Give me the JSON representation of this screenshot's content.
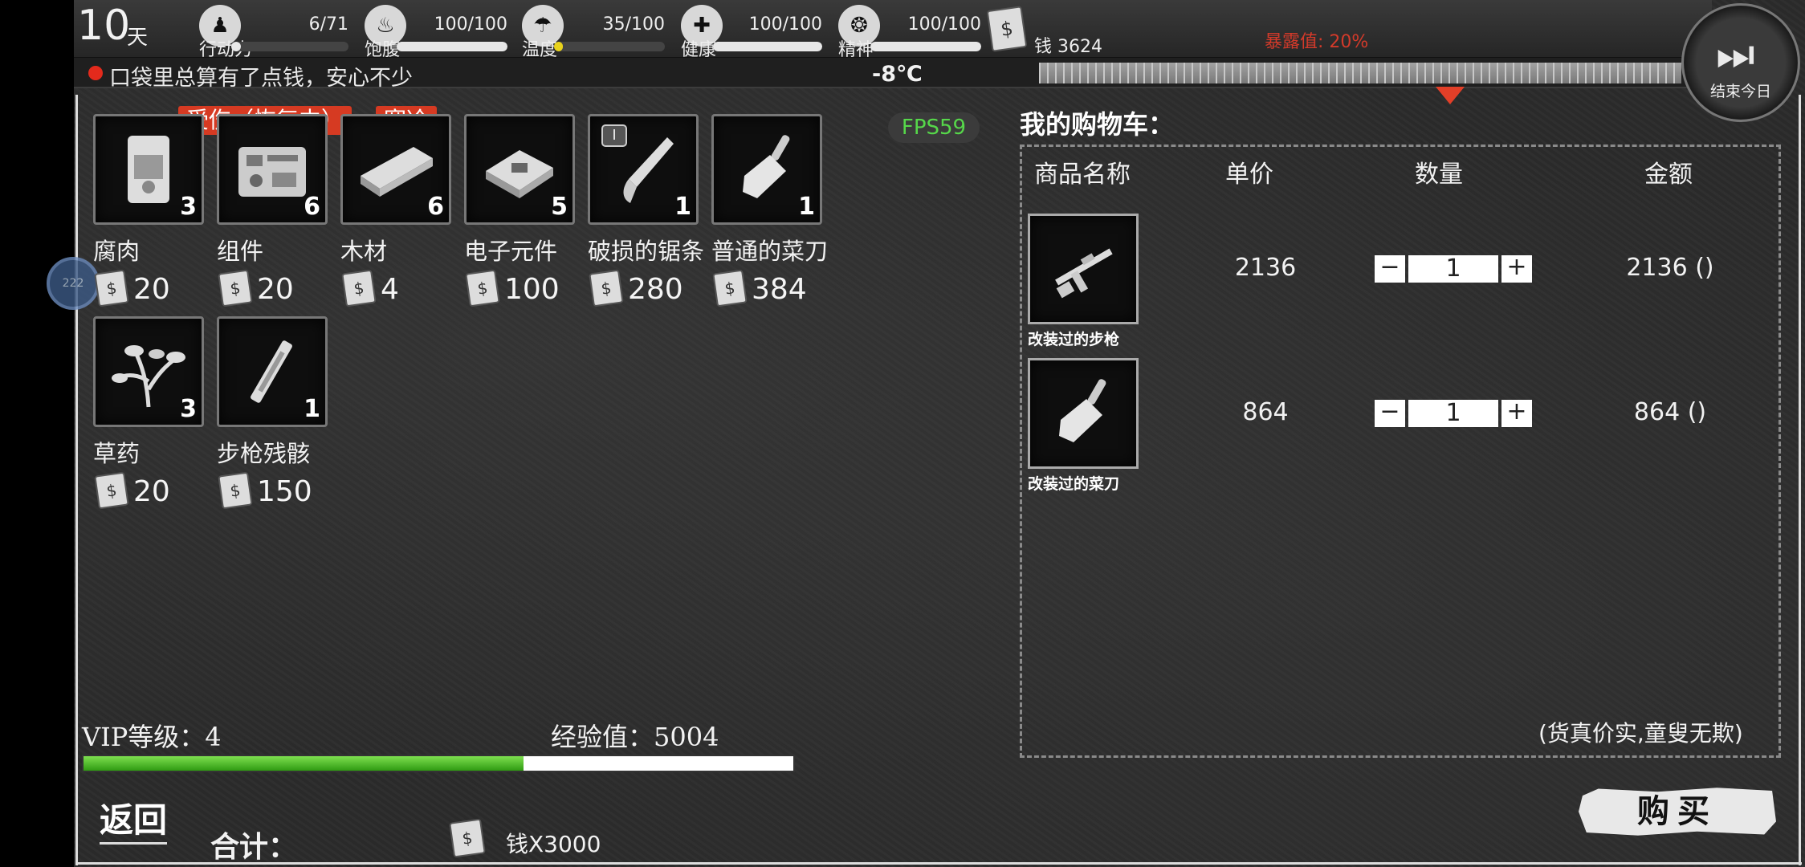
{
  "hud": {
    "day": "10",
    "day_unit": "天",
    "stats": [
      {
        "label": "行动力",
        "value": "6/71",
        "fill": 0.08,
        "icon": "footprint-icon",
        "glyph": "♟"
      },
      {
        "label": "饱腹",
        "value": "100/100",
        "fill": 1.0,
        "icon": "stomach-icon",
        "glyph": "♨"
      },
      {
        "label": "温度",
        "value": "35/100",
        "fill": 0.08,
        "icon": "temperature-icon",
        "glyph": "☂"
      },
      {
        "label": "健康",
        "value": "100/100",
        "fill": 1.0,
        "icon": "health-icon",
        "glyph": "✚"
      },
      {
        "label": "精神",
        "value": "100/100",
        "fill": 1.0,
        "icon": "brain-icon",
        "glyph": "❂"
      }
    ],
    "money": "钱 3624",
    "exposure": "暴露值: 20%",
    "status_message": "口袋里总算有了点钱，安心不少",
    "temperature": "-8℃",
    "end_day_label": "结束今日"
  },
  "status_tags": [
    "受伤（恢复中）",
    "寒冷"
  ],
  "fps": "FPS59",
  "float_button": "222",
  "inventory": [
    {
      "name": "腐肉",
      "count": "3",
      "price": "20",
      "icon": "meat-package-icon"
    },
    {
      "name": "组件",
      "count": "6",
      "price": "20",
      "icon": "components-icon"
    },
    {
      "name": "木材",
      "count": "6",
      "price": "4",
      "icon": "wood-plank-icon"
    },
    {
      "name": "电子元件",
      "count": "5",
      "price": "100",
      "icon": "electronics-icon"
    },
    {
      "name": "破损的锯条",
      "count": "1",
      "price": "280",
      "icon": "saw-blade-icon",
      "badge": "I"
    },
    {
      "name": "普通的菜刀",
      "count": "1",
      "price": "384",
      "icon": "cleaver-icon"
    },
    {
      "name": "草药",
      "count": "3",
      "price": "20",
      "icon": "herb-icon"
    },
    {
      "name": "步枪残骸",
      "count": "1",
      "price": "150",
      "icon": "rifle-wreck-icon"
    }
  ],
  "vip": "VIP等级：4",
  "exp": "经验值：5004",
  "exp_fill": 0.62,
  "cart": {
    "title": "我的购物车：",
    "headers": [
      "商品名称",
      "单价",
      "数量",
      "金额"
    ],
    "rows": [
      {
        "name": "改装过的步枪",
        "unit_price": "2136",
        "qty": "1",
        "amount": "2136 ()",
        "icon": "rifle-icon"
      },
      {
        "name": "改装过的菜刀",
        "unit_price": "864",
        "qty": "1",
        "amount": "864 ()",
        "icon": "cleaver-icon"
      }
    ],
    "slogan": "(货真价实,童叟无欺)"
  },
  "footer": {
    "back": "返回",
    "total_label": "合计：",
    "total_value": "钱X3000",
    "buy": "购买"
  },
  "colors": {
    "accent_red": "#d63a22",
    "exp_green": "#3fae1c",
    "fps_green": "#56d74a"
  }
}
